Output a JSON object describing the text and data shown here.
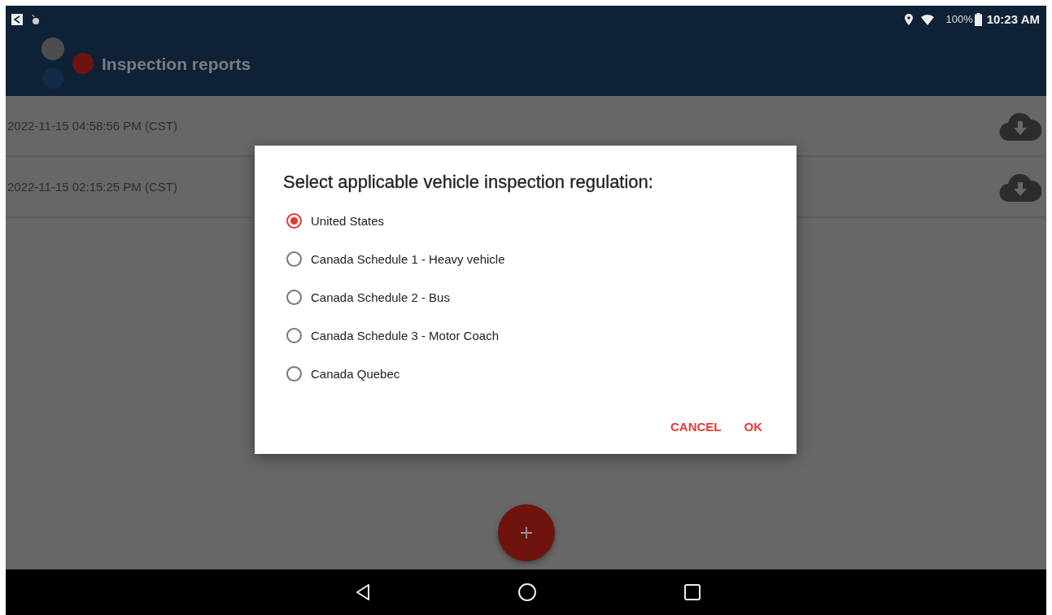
{
  "status_bar": {
    "battery": "100%",
    "time": "10:23 AM"
  },
  "app_bar": {
    "title": "Inspection reports"
  },
  "reports": [
    {
      "timestamp": "2022-11-15 04:58:56 PM (CST)"
    },
    {
      "timestamp": "2022-11-15 02:15:25 PM (CST)"
    }
  ],
  "dialog": {
    "title": "Select applicable vehicle inspection regulation:",
    "options": [
      {
        "label": "United States",
        "selected": true
      },
      {
        "label": "Canada Schedule 1 - Heavy vehicle",
        "selected": false
      },
      {
        "label": "Canada Schedule 2 - Bus",
        "selected": false
      },
      {
        "label": "Canada Schedule 3 - Motor Coach",
        "selected": false
      },
      {
        "label": "Canada Quebec",
        "selected": false
      }
    ],
    "buttons": [
      {
        "label": "CANCEL"
      },
      {
        "label": "OK"
      }
    ]
  }
}
